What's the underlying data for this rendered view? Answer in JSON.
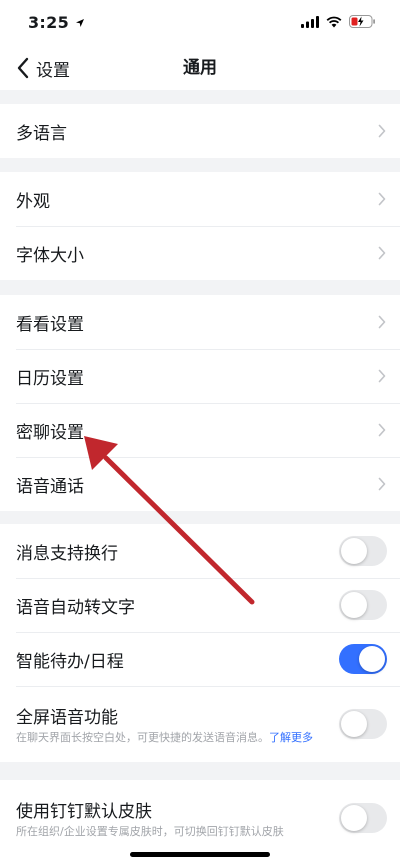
{
  "status_bar": {
    "time": "3:25"
  },
  "nav": {
    "back_label": "设置",
    "title": "通用"
  },
  "groups": {
    "g1": [
      {
        "label": "多语言"
      }
    ],
    "g2": [
      {
        "label": "外观"
      },
      {
        "label": "字体大小"
      }
    ],
    "g3": [
      {
        "label": "看看设置"
      },
      {
        "label": "日历设置"
      },
      {
        "label": "密聊设置"
      },
      {
        "label": "语音通话"
      }
    ],
    "g4": [
      {
        "label": "消息支持换行",
        "on": false
      },
      {
        "label": "语音自动转文字",
        "on": false
      },
      {
        "label": "智能待办/日程",
        "on": true
      },
      {
        "label": "全屏语音功能",
        "desc": "在聊天界面长按空白处，可更快捷的发送语音消息。",
        "link": "了解更多",
        "on": false
      }
    ],
    "g5": [
      {
        "label": "使用钉钉默认皮肤",
        "desc": "所在组织/企业设置专属皮肤时，可切换回钉钉默认皮肤",
        "on": false
      }
    ]
  },
  "colors": {
    "accent": "#3370ff",
    "arrow": "#c1272d",
    "background": "#f2f3f5"
  }
}
